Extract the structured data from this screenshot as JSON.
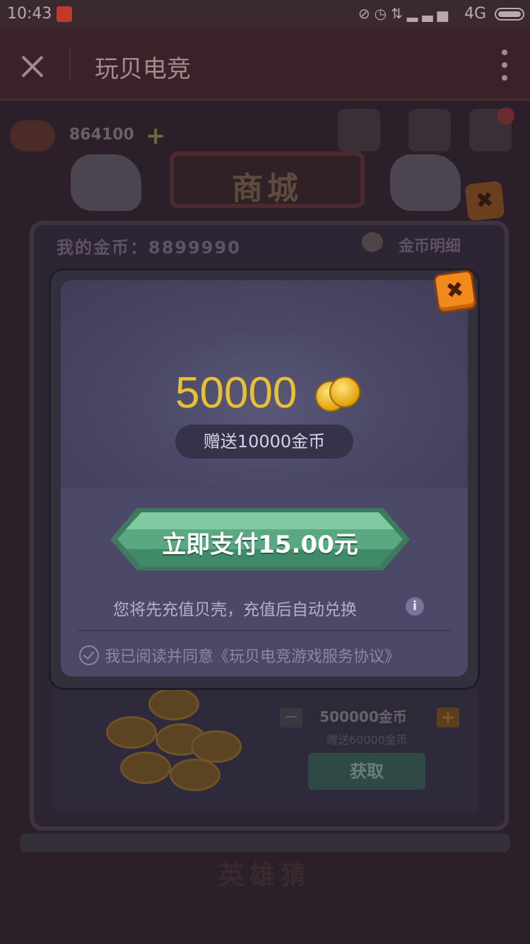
{
  "status_bar": {
    "time": "10:43",
    "network": "4G"
  },
  "app_bar": {
    "title": "玩贝电竞"
  },
  "game_bg": {
    "coin_balance_top": "864100",
    "shop_title": "商城",
    "my_coins_label": "我的金币：8899990",
    "coin_detail_label": "金币明细",
    "package_amount": "500000金币",
    "package_bonus": "赠送60000金币",
    "get_button": "获取",
    "bottom_banner": "英雄猜"
  },
  "modal": {
    "amount": "50000",
    "bonus": "赠送10000金币",
    "pay_button": "立即支付15.00元",
    "hint": "您将先充值贝壳，充值后自动兑换",
    "agreement": "我已阅读并同意《玩贝电竞游戏服务协议》"
  },
  "colors": {
    "amount_gold": "#e7c034",
    "pay_green": "#4e9a78",
    "close_orange": "#f08a1c"
  }
}
